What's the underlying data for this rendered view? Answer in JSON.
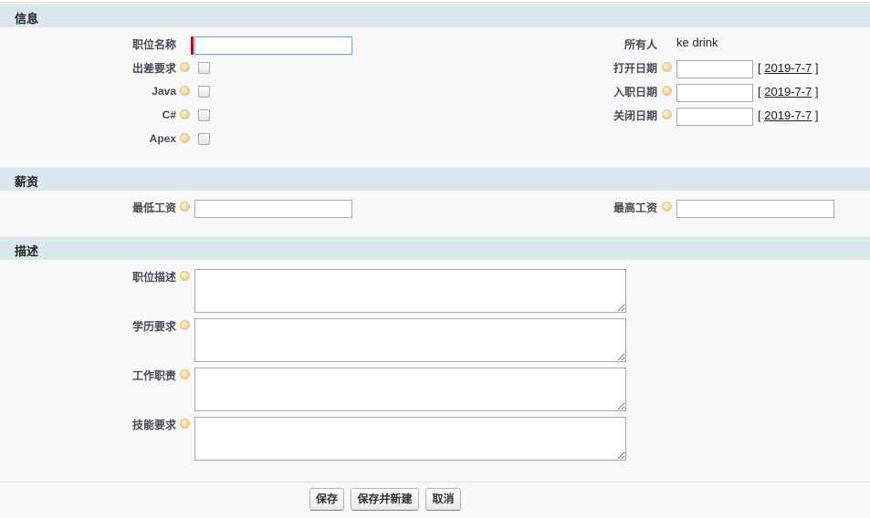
{
  "sections": {
    "info": "信息",
    "salary": "薪资",
    "description": "描述"
  },
  "info": {
    "position_name_label": "职位名称",
    "position_name_value": "",
    "travel_label": "出差要求",
    "java_label": "Java",
    "csharp_label": "C#",
    "apex_label": "Apex",
    "owner_label": "所有人",
    "owner_value": "ke drink",
    "open_date_label": "打开日期",
    "join_date_label": "入职日期",
    "close_date_label": "关闭日期",
    "today_link": "2019-7-7",
    "bracket_open": "[",
    "bracket_close": "]"
  },
  "salary": {
    "min_label": "最低工资",
    "max_label": "最高工资"
  },
  "description": {
    "job_desc_label": "职位描述",
    "education_label": "学历要求",
    "duties_label": "工作职责",
    "skills_label": "技能要求"
  },
  "buttons": {
    "save": "保存",
    "save_new": "保存并新建",
    "cancel": "取消"
  }
}
